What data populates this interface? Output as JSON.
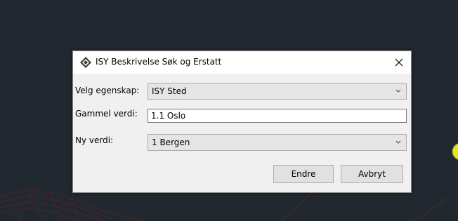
{
  "dialog": {
    "title": "ISY Beskrivelse Søk og Erstatt",
    "icon": "isy-diamond-icon",
    "close_icon": "close-icon"
  },
  "form": {
    "property_label": "Velg egenskap:",
    "property_value": "ISY Sted",
    "old_value_label": "Gammel verdi:",
    "old_value": "1.1 Oslo",
    "new_value_label": "Ny verdi:",
    "new_value": "1 Bergen"
  },
  "buttons": {
    "change_label": "Endre",
    "cancel_label": "Avbryt"
  },
  "colors": {
    "background": "#212830",
    "dialog": "#f0f0f0",
    "titlebar": "#ffffff",
    "combo": "#e5e5e5",
    "button": "#e1e1e1",
    "accent_yellow": "#e6e61e",
    "accent_red": "#8b2a2a"
  }
}
